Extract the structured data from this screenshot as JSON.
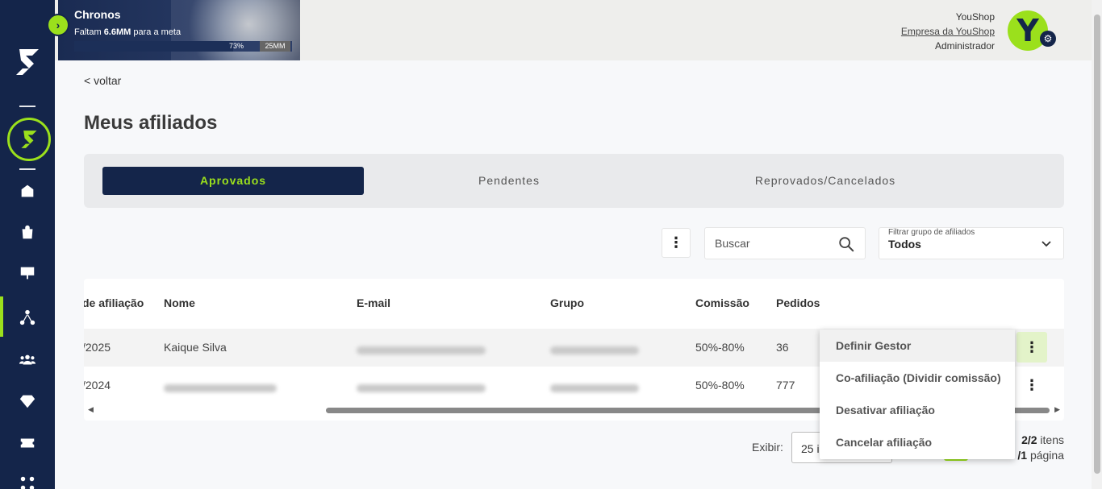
{
  "banner": {
    "title": "Chronos",
    "subtitle_prefix": "Faltam",
    "subtitle_amount": "6.6MM",
    "subtitle_suffix": "para a meta",
    "progress_label": "73%",
    "progress_value": 0.73,
    "goal_label": "25MM"
  },
  "user": {
    "name": "YouShop",
    "company": "Empresa da YouShop",
    "role": "Administrador",
    "avatar_letter": "Y"
  },
  "nav": {
    "back_label": "< voltar"
  },
  "page": {
    "title": "Meus afiliados"
  },
  "tabs": [
    {
      "label": "Aprovados",
      "active": true
    },
    {
      "label": "Pendentes",
      "active": false
    },
    {
      "label": "Reprovados/Cancelados",
      "active": false
    }
  ],
  "search": {
    "placeholder": "Buscar"
  },
  "filter": {
    "label": "Filtrar grupo de afiliados",
    "value": "Todos"
  },
  "table": {
    "headers": [
      "de afiliação",
      "Nome",
      "E-mail",
      "Grupo",
      "Comissão",
      "Pedidos"
    ],
    "rows": [
      {
        "date": "/2025",
        "name": "Kaique Silva",
        "email": "",
        "group": "",
        "commission": "50%-80%",
        "orders": "36"
      },
      {
        "date": "/2024",
        "name": "",
        "email": "",
        "group": "",
        "commission": "50%-80%",
        "orders": "777"
      }
    ]
  },
  "row_menu": {
    "items": [
      "Definir Gestor",
      "Co-afiliação (Dividir comissão)",
      "Desativar afiliação",
      "Cancelar afiliação"
    ]
  },
  "pagination": {
    "show_label": "Exibir:",
    "page_size": "25 i",
    "items_count": "2/2",
    "items_suffix": "itens",
    "page_count": "/1",
    "page_suffix": "página"
  },
  "colors": {
    "sidebar": "#14254a",
    "accent": "#9be01c"
  }
}
